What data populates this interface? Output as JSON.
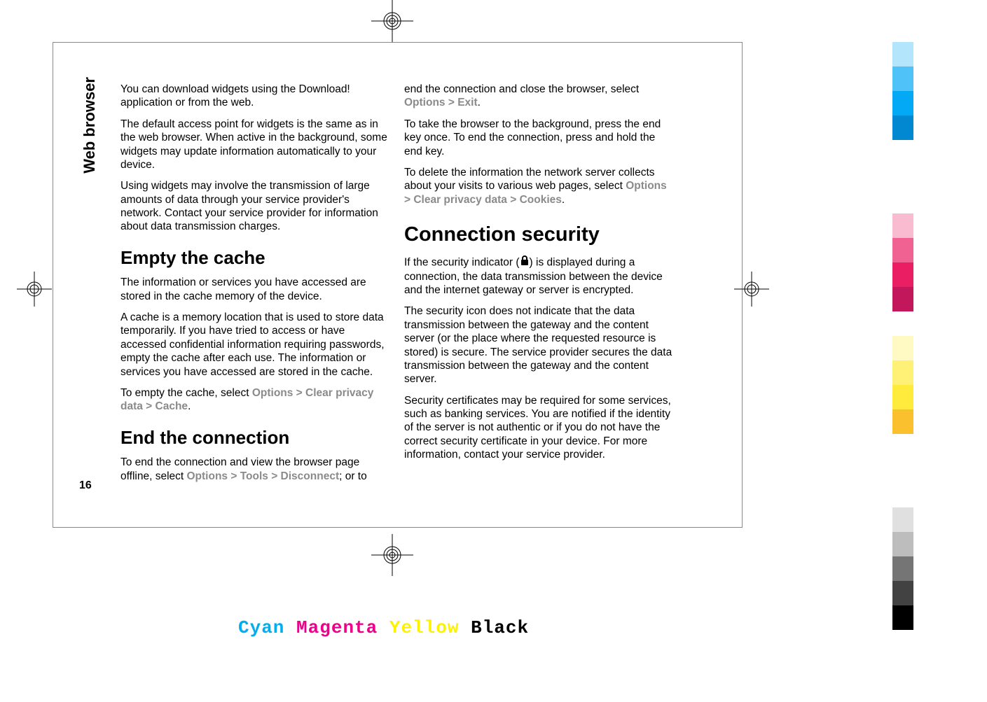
{
  "sideTab": "Web browser",
  "pageNumber": "16",
  "col1": {
    "p1": "You can download widgets using the Download! application or from the web.",
    "p2": "The default access point for widgets is the same as in the web browser. When active in the background, some widgets may update information automatically to your device.",
    "p3": "Using widgets may involve the transmission of large amounts of data through your service provider's network. Contact your service provider for information about data transmission charges.",
    "h1": "Empty the cache",
    "p4": "The information or services you have accessed are stored in the cache memory of the device.",
    "p5": "A cache is a memory location that is used to store data temporarily. If you have tried to access or have accessed confidential information requiring passwords, empty the cache after each use. The information or services you have accessed are stored in the cache.",
    "p6a": "To empty the cache, select ",
    "p6menu": "Options > Clear privacy data > Cache",
    "p6b": ".",
    "h2": "End the connection",
    "p7a": "To end the connection and view the browser page offline, select ",
    "p7menu": "Options > Tools > Disconnect",
    "p7b": "; or to"
  },
  "col2": {
    "p1a": "end the connection and close the browser, select ",
    "p1menu": "Options > Exit",
    "p1b": ".",
    "p2": "To take the browser to the background, press the end key once. To end the connection, press and hold the end key.",
    "p3a": "To delete the information the network server collects about your visits to various web pages, select ",
    "p3menu": "Options > Clear privacy data > Cookies",
    "p3b": ".",
    "h1": "Connection security",
    "p4a": "If the security indicator (",
    "p4b": ") is displayed during a connection, the data transmission between the device and the internet gateway or server is encrypted.",
    "p5": "The security icon does not indicate that the data transmission between the gateway and the content server (or the place where the requested resource is stored) is secure. The service provider secures the data transmission between the gateway and the content server.",
    "p6": "Security certificates may be required for some services, such as banking services. You are notified if the identity of the server is not authentic or if you do not have the correct security certificate in your device. For more information, contact your service provider."
  },
  "colorLabels": {
    "cyan": "Cyan",
    "magenta": "Magenta",
    "yellow": "Yellow",
    "black": "Black"
  },
  "colorBars": [
    "#b3e5fc",
    "#4fc3f7",
    "#03a9f4",
    "#0288d1",
    "#ffffff",
    "#ffffff",
    "#ffffff",
    "#f8bbd0",
    "#f06292",
    "#e91e63",
    "#c2185b",
    "#ffffff",
    "#fff9c4",
    "#fff176",
    "#ffeb3b",
    "#fbc02d",
    "#ffffff",
    "#ffffff",
    "#ffffff",
    "#e0e0e0",
    "#bdbdbd",
    "#757575",
    "#424242",
    "#000000"
  ]
}
